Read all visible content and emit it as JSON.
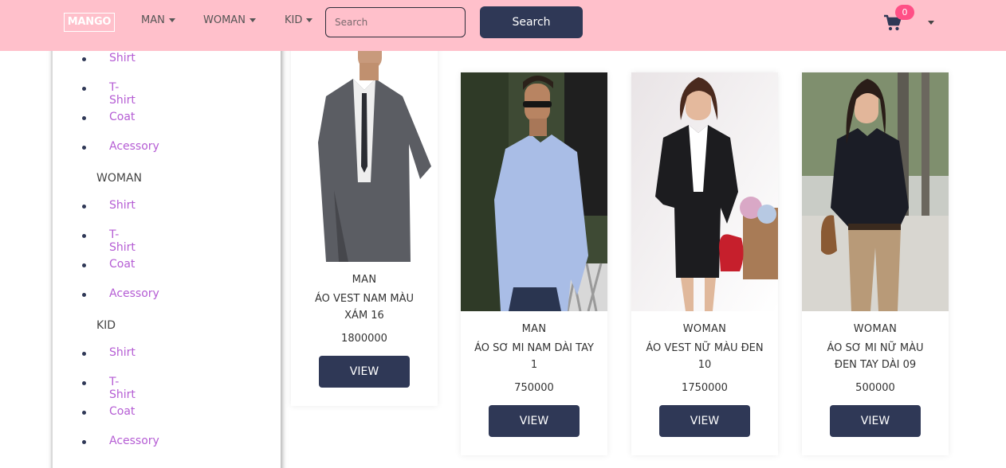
{
  "navbar": {
    "brand": "MANGO",
    "menu": [
      {
        "label": "MAN"
      },
      {
        "label": "WOMAN"
      },
      {
        "label": "KID"
      }
    ],
    "search_placeholder": "Search",
    "search_button": "Search",
    "cart_count": "0"
  },
  "sidebar": {
    "groups": [
      {
        "heading": "",
        "items": [
          "Shirt",
          "T-Shirt",
          "Coat",
          "Acessory"
        ]
      },
      {
        "heading": "WOMAN",
        "items": [
          "Shirt",
          "T-Shirt",
          "Coat",
          "Acessory"
        ]
      },
      {
        "heading": "KID",
        "items": [
          "Shirt",
          "T-Shirt",
          "Coat",
          "Acessory"
        ]
      }
    ]
  },
  "products": [
    {
      "category": "MAN",
      "name": "ÁO VEST NAM MÀU XÁM 16",
      "price": "1800000",
      "button": "VIEW"
    },
    {
      "category": "MAN",
      "name": "ÁO SƠ MI NAM DÀI TAY 1",
      "price": "750000",
      "button": "VIEW"
    },
    {
      "category": "WOMAN",
      "name": "ÁO VEST NỮ MÀU ĐEN 10",
      "price": "1750000",
      "button": "VIEW"
    },
    {
      "category": "WOMAN",
      "name": "ÁO SƠ MI NỮ MÀU ĐEN TAY DÀI 09",
      "price": "500000",
      "button": "VIEW"
    }
  ]
}
